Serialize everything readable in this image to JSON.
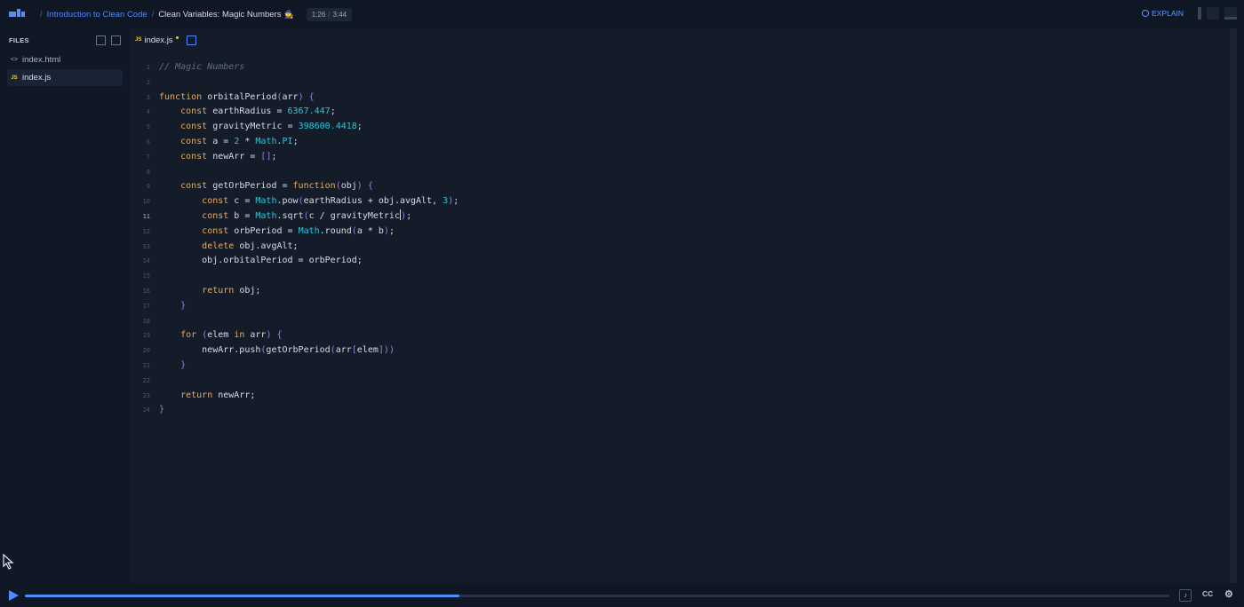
{
  "breadcrumb": {
    "course": "Introduction to Clean Code",
    "lesson": "Clean Variables: Magic Numbers",
    "lesson_emoji": "🧙"
  },
  "playback": {
    "current": "1:26",
    "total": "3:44",
    "progress": 0.38
  },
  "toolbar": {
    "explain_label": "EXPLAIN"
  },
  "sidebar": {
    "header": "FILES",
    "files": [
      {
        "name": "index.html",
        "icon": "html-icon"
      },
      {
        "name": "index.js",
        "icon": "js-icon",
        "active": true
      }
    ]
  },
  "editor": {
    "tab": {
      "name": "index.js",
      "icon_text": "JS",
      "unsaved": true
    },
    "current_line": 11,
    "lines": [
      "// Magic Numbers",
      "",
      "function orbitalPeriod(arr) {",
      "    const earthRadius = 6367.447;",
      "    const gravityMetric = 398600.4418;",
      "    const a = 2 * Math.PI;",
      "    const newArr = [];",
      "",
      "    const getOrbPeriod = function(obj) {",
      "        const c = Math.pow(earthRadius + obj.avgAlt, 3);",
      "        const b = Math.sqrt(c / gravityMetric);",
      "        const orbPeriod = Math.round(a * b);",
      "        delete obj.avgAlt;",
      "        obj.orbitalPeriod = orbPeriod;",
      "",
      "        return obj;",
      "    }",
      "",
      "    for (elem in arr) {",
      "        newArr.push(getOrbPeriod(arr[elem]))",
      "    }",
      "",
      "    return newArr;",
      "}"
    ]
  },
  "player": {
    "cc_label": "CC",
    "js_icon_text": "JS",
    "html_icon_text": "<>"
  }
}
